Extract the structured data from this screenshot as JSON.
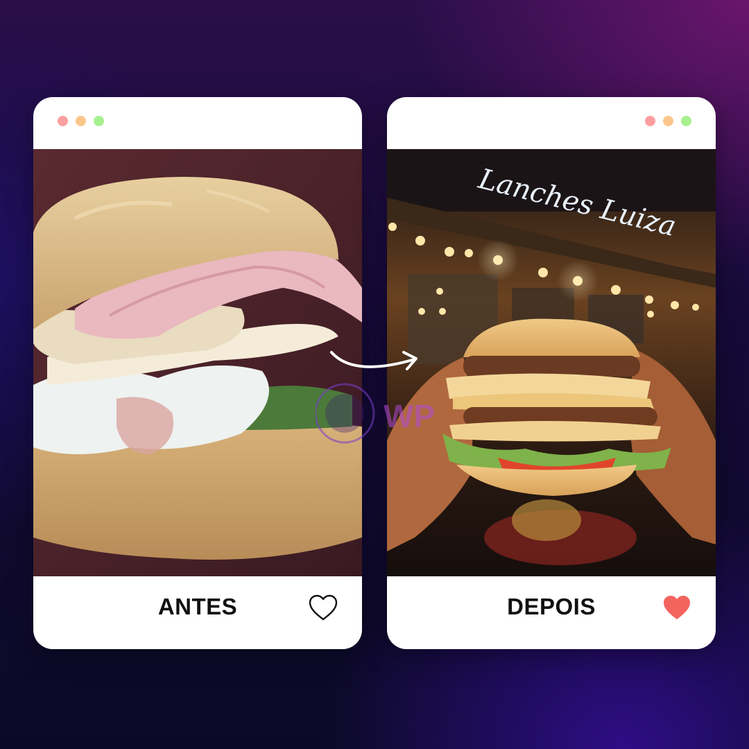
{
  "theme": {
    "dot_colors": [
      "#fb9ea0",
      "#fbc68c",
      "#a6f08f"
    ],
    "heart_filled_color": "#f4645f",
    "heart_outline_color": "#111111"
  },
  "cards": [
    {
      "label": "ANTES",
      "heart_icon": "heart-outline-icon",
      "photo_subject": "sandwich-photo"
    },
    {
      "label": "DEPOIS",
      "heart_icon": "heart-filled-icon",
      "photo_subject": "burger-photo",
      "sign_text": "Lanches Luiza"
    }
  ],
  "watermark": {
    "text": "WP"
  }
}
